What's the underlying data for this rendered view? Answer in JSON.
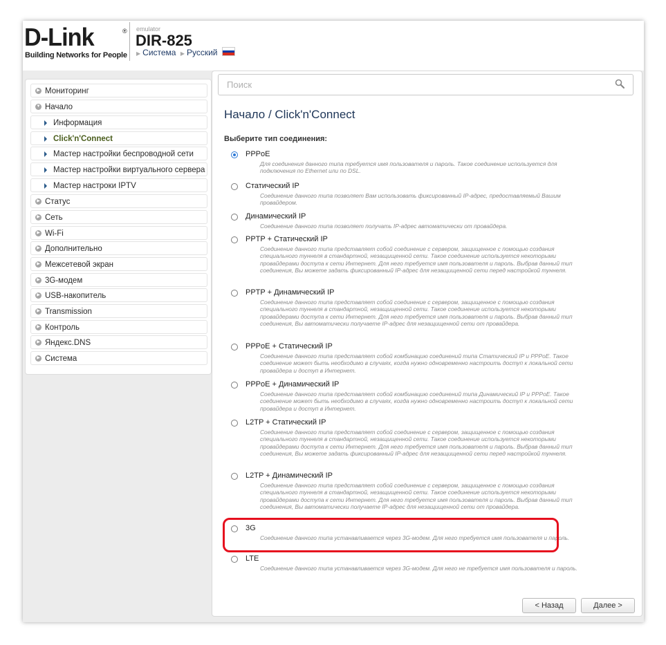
{
  "header": {
    "logo_text": "D-Link",
    "logo_registered": "®",
    "logo_tagline": "Building Networks for People",
    "emulator_label": "emulator",
    "model": "DIR-825",
    "nav_system": "Система",
    "nav_language": "Русский"
  },
  "colors": {
    "flag_white": "#ffffff",
    "flag_blue": "#0039a6",
    "flag_red": "#d52b1e",
    "highlight": "#e6101e",
    "radio_checked": "#2a78d6"
  },
  "sidebar": {
    "items": [
      {
        "label": "Мониторинг"
      },
      {
        "label": "Начало"
      },
      {
        "label": "Информация"
      },
      {
        "label": "Click'n'Connect"
      },
      {
        "label": "Мастер настройки беспроводной сети"
      },
      {
        "label": "Мастер настройки виртуального сервера"
      },
      {
        "label": "Мастер настроки IPTV"
      },
      {
        "label": "Статус"
      },
      {
        "label": "Сеть"
      },
      {
        "label": "Wi-Fi"
      },
      {
        "label": "Дополнительно"
      },
      {
        "label": "Межсетевой экран"
      },
      {
        "label": "3G-модем"
      },
      {
        "label": "USB-накопитель"
      },
      {
        "label": "Transmission"
      },
      {
        "label": "Контроль"
      },
      {
        "label": "Яндекс.DNS"
      },
      {
        "label": "Система"
      }
    ]
  },
  "search": {
    "placeholder": "Поиск"
  },
  "main": {
    "title": "Начало /  Click'n'Connect",
    "prompt": "Выберите тип соединения:",
    "options": [
      {
        "label": "PPPoE",
        "checked": true,
        "desc": "Для соединения данного типа требуется имя пользователя и пароль. Такое соединение используется для подключения по Ethernet или по DSL."
      },
      {
        "label": "Статический IP",
        "checked": false,
        "desc": "Соединение данного типа позволяет Вам использовать фиксированный IP-адрес, предоставляемый Вашим провайдером."
      },
      {
        "label": "Динамический IP",
        "checked": false,
        "desc": "Соединение данного типа позволяет получать IP-адрес автоматически от провайдера."
      },
      {
        "label": "PPTP + Статический IP",
        "checked": false,
        "desc": "Соединение данного типа представляет собой соединение с сервером, защищенное с помощью создания специального туннеля в стандартной, незащищенной сети. Такое соединение используется некоторыми провайдерами доступа к сети Интернет. Для него требуется имя пользователя и пароль. Выбрав данный тип соединения, Вы можете задать фиксированный IP-адрес для незащищенной сети перед настройкой туннеля."
      },
      {
        "label": "PPTP + Динамический IP",
        "checked": false,
        "desc": "Соединение данного типа представляет собой соединение с сервером, защищенное с помощью создания специального туннеля в стандартной, незащищенной сети. Такое соединение используется некоторыми провайдерами доступа к сети Интернет. Для него требуется имя пользователя и пароль. Выбрав данный тип соединения, Вы автоматически получаете IP-адрес для незащищенной сети от провайдера."
      },
      {
        "label": "PPPoE + Статический IP",
        "checked": false,
        "desc": "Соединение данного типа представляет собой комбинацию соединений типа Статический IP и PPPoE. Такое соединение может быть необходимо в случаях, когда нужно одновременно настроить доступ к локальной сети провайдера и доступ в Интернет."
      },
      {
        "label": "PPPoE + Динамический IP",
        "checked": false,
        "desc": "Соединение данного типа представляет собой комбинацию соединений типа Динамический IP и PPPoE. Такое соединение может быть необходимо в случаях, когда нужно одновременно настроить доступ к локальной сети провайдера и доступ в Интернет."
      },
      {
        "label": "L2TP + Статический IP",
        "checked": false,
        "desc": "Соединение данного типа представляет собой соединение с сервером, защищенное с помощью создания специального туннеля в стандартной, незащищенной сети. Такое соединение используется некоторыми провайдерами доступа к сети Интернет. Для него требуется имя пользователя и пароль. Выбрав данный тип соединения, Вы можете задать фиксированный IP-адрес для незащищенной сети перед настройкой туннеля."
      },
      {
        "label": "L2TP + Динамический IP",
        "checked": false,
        "desc": "Соединение данного типа представляет собой соединение с сервером, защищенное с помощью создания специального туннеля в стандартной, незащищенной сети. Такое соединение используется некоторыми провайдерами доступа к сети Интернет. Для него требуется имя пользователя и пароль. Выбрав данный тип соединения, Вы автоматически получаете IP-адрес для незащищенной сети от провайдера."
      },
      {
        "label": "3G",
        "checked": false,
        "desc": "Соединение данного типа устанавливается через 3G-модем. Для него требуется имя пользователя и пароль."
      },
      {
        "label": "LTE",
        "checked": false,
        "desc": "Соединение данного типа устанавливается через 3G-модем. Для него не требуется имя пользователя и пароль."
      }
    ],
    "back_label": "< Назад",
    "next_label": "Далее >"
  }
}
